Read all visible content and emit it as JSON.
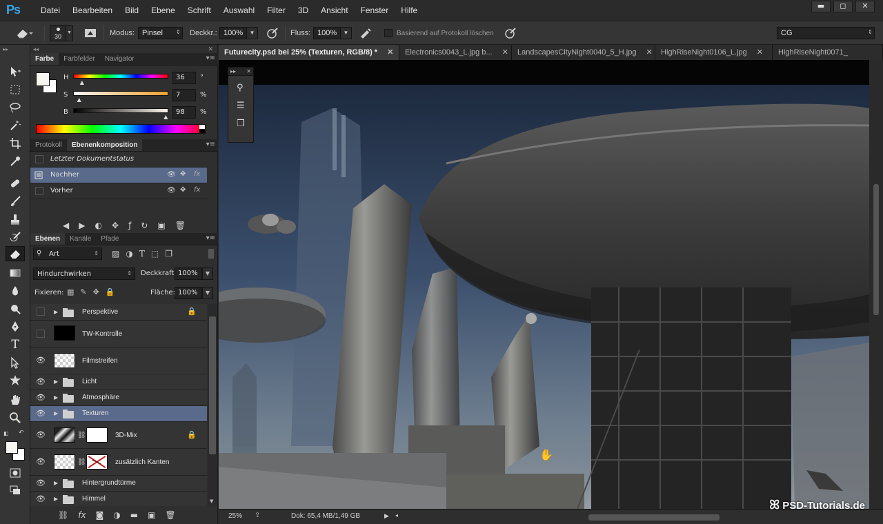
{
  "app": {
    "logo": "Ps",
    "menu": [
      "Datei",
      "Bearbeiten",
      "Bild",
      "Ebene",
      "Schrift",
      "Auswahl",
      "Filter",
      "3D",
      "Ansicht",
      "Fenster",
      "Hilfe"
    ],
    "window_controls": {
      "minimize": "▬",
      "restore": "◻",
      "close": "✕"
    }
  },
  "options": {
    "brush_size": "30",
    "modus_label": "Modus:",
    "modus_value": "Pinsel",
    "deckkraft_label": "Deckkr.:",
    "deckkraft_value": "100%",
    "fluss_label": "Fluss:",
    "fluss_value": "100%",
    "protokoll_label": "Basierend auf Protokoll löschen",
    "workspace": "CG"
  },
  "color_panel": {
    "tabs": [
      "Farbe",
      "Farbfelder",
      "Navigator"
    ],
    "h": {
      "label": "H",
      "value": "36",
      "unit": "°",
      "fraction": 0.1
    },
    "s": {
      "label": "S",
      "value": "7",
      "unit": "%",
      "fraction": 0.07
    },
    "b": {
      "label": "B",
      "value": "98",
      "unit": "%",
      "fraction": 0.98
    }
  },
  "comp_panel": {
    "tabs": [
      "Protokoll",
      "Ebenenkomposition"
    ],
    "rows": [
      {
        "label": "Letzter Dokumentstatus"
      },
      {
        "label": "Nachher"
      },
      {
        "label": "Vorher"
      }
    ]
  },
  "layers_panel": {
    "tabs": [
      "Ebenen",
      "Kanäle",
      "Pfade"
    ],
    "filter_label": "Art",
    "blend_mode": "Hindurchwirken",
    "deckkraft_label": "Deckkraft:",
    "deckkraft_value": "100%",
    "fixieren_label": "Fixieren:",
    "flaeche_label": "Fläche:",
    "flaeche_value": "100%",
    "layers": [
      {
        "name": "Perspektive"
      },
      {
        "name": "TW-Kontrolle"
      },
      {
        "name": "Filmstreifen"
      },
      {
        "name": "Licht"
      },
      {
        "name": "Atmosphäre"
      },
      {
        "name": "Texturen"
      },
      {
        "name": "3D-Mix"
      },
      {
        "name": "zusätzlich Kanten"
      },
      {
        "name": "Hintergrundtürme"
      },
      {
        "name": "Himmel"
      }
    ]
  },
  "document": {
    "tabs": [
      {
        "label": "Futurecity.psd bei 25% (Texturen, RGB/8) *"
      },
      {
        "label": "Electronics0043_L.jpg b..."
      },
      {
        "label": "LandscapesCityNight0040_5_H.jpg"
      },
      {
        "label": "HighRiseNight0106_L.jpg"
      },
      {
        "label": "HighRiseNight0071_"
      }
    ],
    "zoom": "25%",
    "doc_info": "Dok: 65,4 MB/1,49 GB",
    "watermark": "PSD-Tutorials.de"
  }
}
